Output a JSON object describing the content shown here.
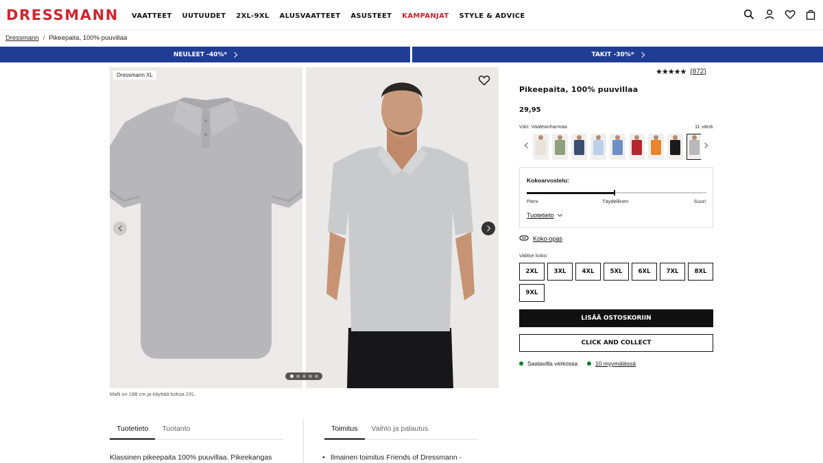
{
  "header": {
    "logo": "DRESSMANN",
    "nav": [
      "VAATTEET",
      "UUTUUDET",
      "2XL-9XL",
      "ALUSVAATTEET",
      "ASUSTEET",
      "KAMPANJAT",
      "STYLE & ADVICE"
    ],
    "icons": [
      "search-icon",
      "account-icon",
      "heart-icon",
      "bag-icon"
    ]
  },
  "breadcrumb": {
    "home": "Dressmann",
    "separator": "/",
    "current": "Pikeepaita, 100% puuvillaa"
  },
  "promos": [
    "NEULEET -40%*",
    "TAKIT -30%*"
  ],
  "gallery": {
    "brand_tag": "Dressmann XL",
    "model_note": "Malli on 188 cm ja käyttää kokoa 2XL.",
    "dot_count": 5,
    "active_dot": 0
  },
  "product": {
    "rating_stars": "★★★★★",
    "rating_count": "(872)",
    "title": "Pikeepaita, 100% puuvillaa",
    "price": "29,95",
    "color_label": "Väri: Vaaleanharmaa",
    "color_count": "11 väriä"
  },
  "swatches": [
    {
      "color": "#e9e3da"
    },
    {
      "color": "#8fa07e"
    },
    {
      "color": "#3b4f73"
    },
    {
      "color": "#bcd0ea"
    },
    {
      "color": "#6d8fc3"
    },
    {
      "color": "#b3262f"
    },
    {
      "color": "#e8842c"
    },
    {
      "color": "#1a1a1a"
    },
    {
      "color": "#b9b9bb"
    }
  ],
  "selected_swatch": 8,
  "fit": {
    "title": "Kokoarvostelu:",
    "low": "Pieni",
    "mid": "Täydellinen",
    "high": "Suuri",
    "value": 0.49,
    "info_link": "Tuotetieto"
  },
  "size_guide": "Koko-opas",
  "size_label": "Valitse koko:",
  "sizes": [
    "2XL",
    "3XL",
    "4XL",
    "5XL",
    "6XL",
    "7XL",
    "8XL",
    "9XL"
  ],
  "buttons": {
    "add_to_cart": "LISÄÄ OSTOSKORIIN",
    "click_collect": "CLICK AND COLLECT"
  },
  "availability": {
    "online": "Saatavilla verkossa",
    "stores": "10 myymälässä"
  },
  "tabs_left": [
    "Tuotetieto",
    "Tuotanto"
  ],
  "tabs_right": [
    "Toimitus",
    "Vaihto ja palautus"
  ],
  "description": "Klassinen pikeepaita 100% puuvillaa. Pikeekangas",
  "delivery_bullet": "Ilmainen toimitus Friends of Dressmann -",
  "colors": {
    "brand_red": "#d1242f",
    "promo_blue": "#1f3d95",
    "available_green": "#0b7a2a"
  }
}
